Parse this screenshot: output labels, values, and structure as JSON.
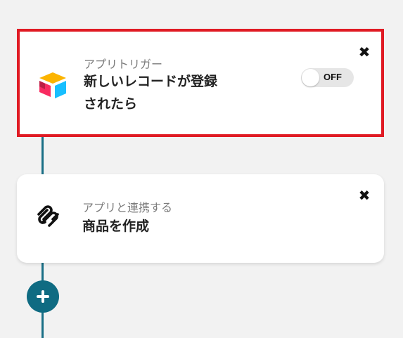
{
  "trigger_card": {
    "label": "アプリトリガー",
    "title_line1": "新しいレコードが登録",
    "title_line2": "されたら",
    "toggle_text": "OFF",
    "close_symbol": "✖",
    "app_icon": "airtable-icon"
  },
  "action_card": {
    "label": "アプリと連携する",
    "title": "商品を作成",
    "close_symbol": "✖",
    "app_icon": "squarespace-icon"
  },
  "add_button": {
    "icon": "plus-icon"
  },
  "colors": {
    "highlight_border": "#e01b24",
    "connector": "#1a6f86",
    "add_button": "#0f6b82"
  }
}
